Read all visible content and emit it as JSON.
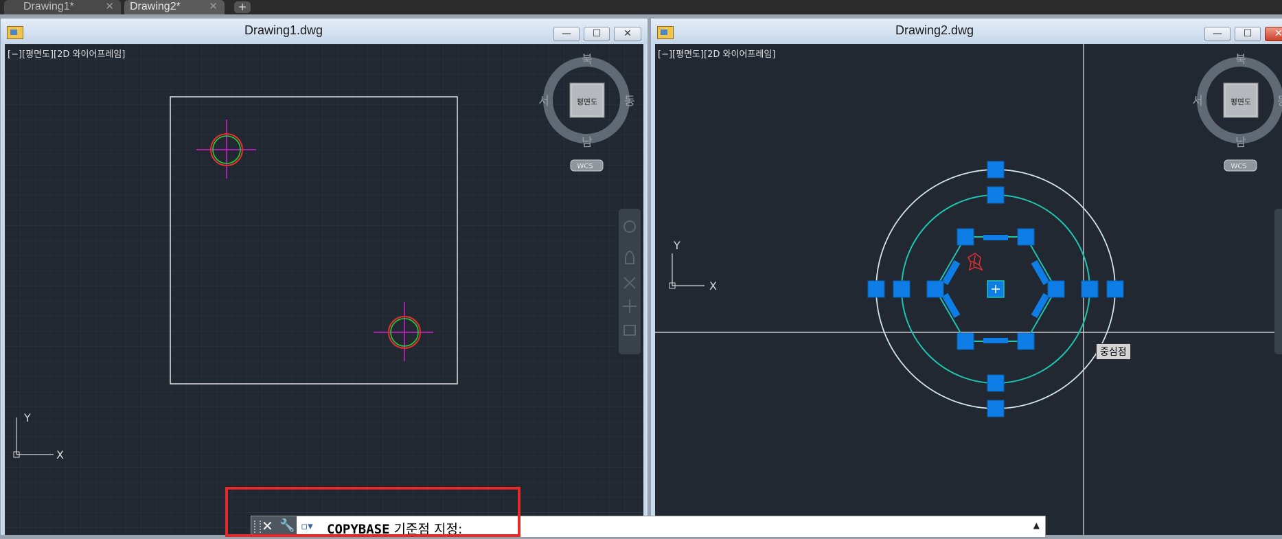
{
  "tabs": [
    {
      "label": "Drawing1*",
      "close": "✕"
    },
    {
      "label": "Drawing2*",
      "close": "✕"
    }
  ],
  "new_tab_icon": "+",
  "windows": [
    {
      "title": "Drawing1.dwg",
      "viewport_label": "[−][평면도][2D 와이어프레임]",
      "buttons": {
        "minimize": "—",
        "maximize": "☐",
        "close": "✕"
      }
    },
    {
      "title": "Drawing2.dwg",
      "viewport_label": "[−][평면도][2D 와이어프레임]",
      "buttons": {
        "minimize": "—",
        "maximize": "☐",
        "close": "✕"
      }
    }
  ],
  "viewcube": {
    "north": "북",
    "south": "남",
    "west": "서",
    "east": "동",
    "face": "평면도",
    "wcs": "WCS"
  },
  "ucs": {
    "x": "X",
    "y": "Y"
  },
  "tooltip": "중심점",
  "command_line": {
    "command": "COPYBASE",
    "prompt": " 기준점  지정:",
    "close_icon": "✕",
    "wrench_icon": "🔧",
    "expand_icon": "▲"
  },
  "colors": {
    "viewport_bg": "#212832",
    "grip_blue": "#0f7de6",
    "teal": "#1fc4b0",
    "highlight_red": "#e32b2b"
  }
}
